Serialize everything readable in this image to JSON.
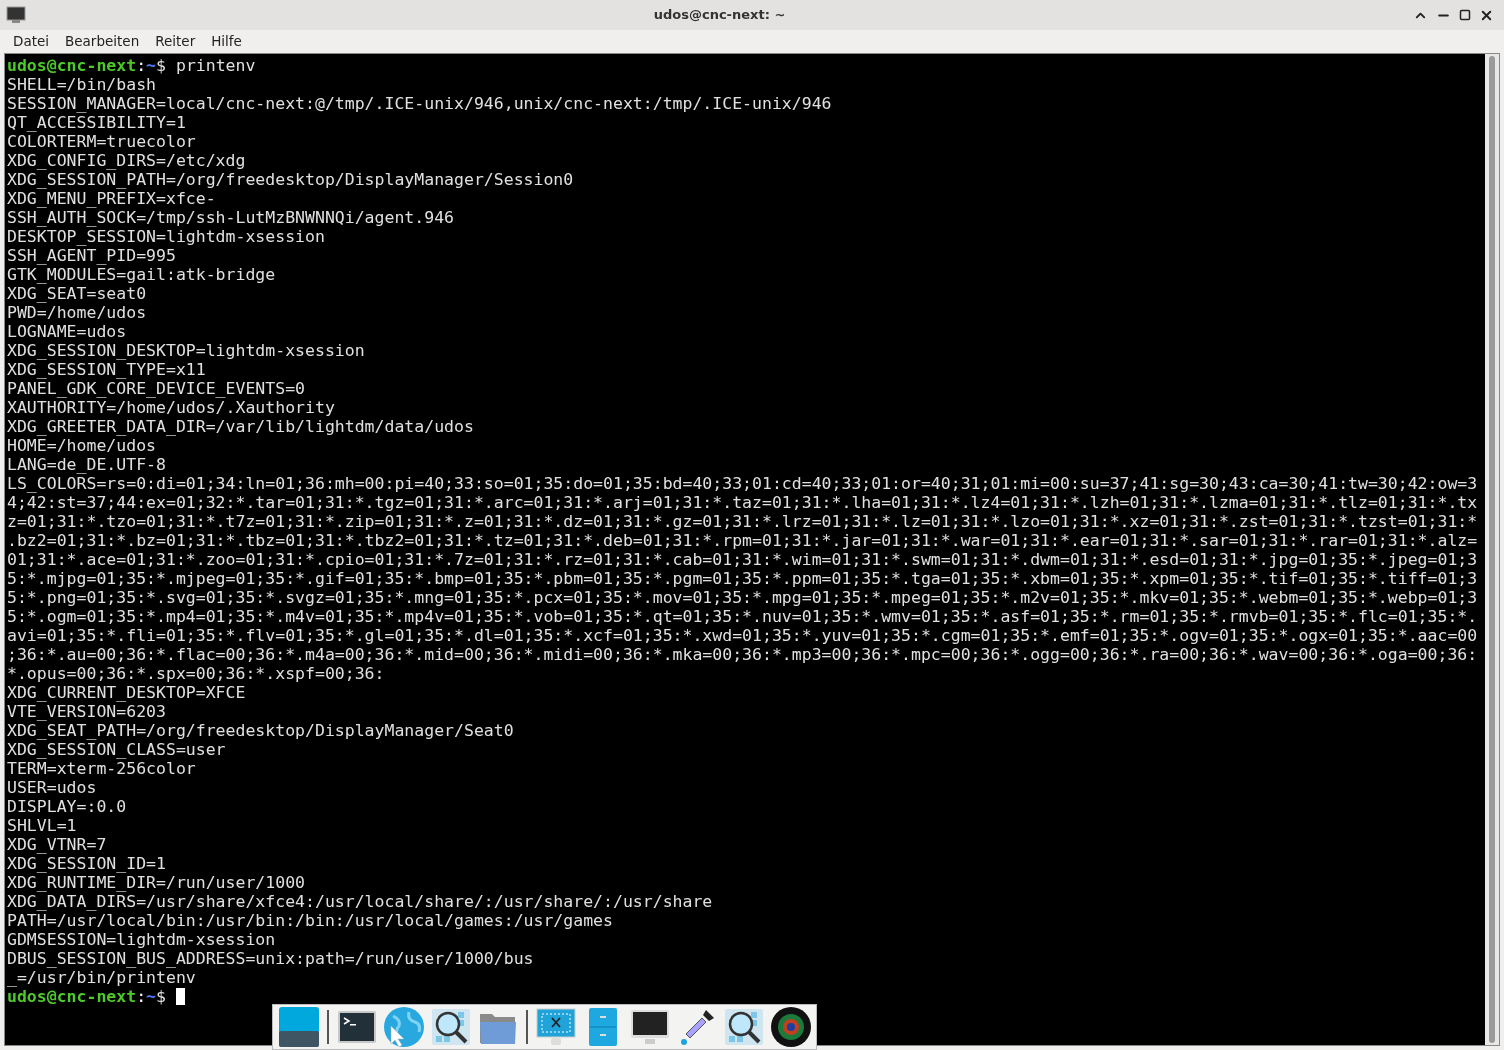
{
  "window": {
    "title": "udos@cnc-next: ~"
  },
  "menu": [
    "Datei",
    "Bearbeiten",
    "Reiter",
    "Hilfe"
  ],
  "terminal": {
    "lines": [
      {
        "kind": "prompt",
        "user": "udos@cnc-next",
        "separator": ":",
        "path": "~",
        "symbol": "$",
        "command": "printenv",
        "cursor": false
      },
      {
        "kind": "output",
        "text": "SHELL=/bin/bash"
      },
      {
        "kind": "output",
        "text": "SESSION_MANAGER=local/cnc-next:@/tmp/.ICE-unix/946,unix/cnc-next:/tmp/.ICE-unix/946"
      },
      {
        "kind": "output",
        "text": "QT_ACCESSIBILITY=1"
      },
      {
        "kind": "output",
        "text": "COLORTERM=truecolor"
      },
      {
        "kind": "output",
        "text": "XDG_CONFIG_DIRS=/etc/xdg"
      },
      {
        "kind": "output",
        "text": "XDG_SESSION_PATH=/org/freedesktop/DisplayManager/Session0"
      },
      {
        "kind": "output",
        "text": "XDG_MENU_PREFIX=xfce-"
      },
      {
        "kind": "output",
        "text": "SSH_AUTH_SOCK=/tmp/ssh-LutMzBNWNNQi/agent.946"
      },
      {
        "kind": "output",
        "text": "DESKTOP_SESSION=lightdm-xsession"
      },
      {
        "kind": "output",
        "text": "SSH_AGENT_PID=995"
      },
      {
        "kind": "output",
        "text": "GTK_MODULES=gail:atk-bridge"
      },
      {
        "kind": "output",
        "text": "XDG_SEAT=seat0"
      },
      {
        "kind": "output",
        "text": "PWD=/home/udos"
      },
      {
        "kind": "output",
        "text": "LOGNAME=udos"
      },
      {
        "kind": "output",
        "text": "XDG_SESSION_DESKTOP=lightdm-xsession"
      },
      {
        "kind": "output",
        "text": "XDG_SESSION_TYPE=x11"
      },
      {
        "kind": "output",
        "text": "PANEL_GDK_CORE_DEVICE_EVENTS=0"
      },
      {
        "kind": "output",
        "text": "XAUTHORITY=/home/udos/.Xauthority"
      },
      {
        "kind": "output",
        "text": "XDG_GREETER_DATA_DIR=/var/lib/lightdm/data/udos"
      },
      {
        "kind": "output",
        "text": "HOME=/home/udos"
      },
      {
        "kind": "output",
        "text": "LANG=de_DE.UTF-8"
      },
      {
        "kind": "output",
        "text": "LS_COLORS=rs=0:di=01;34:ln=01;36:mh=00:pi=40;33:so=01;35:do=01;35:bd=40;33;01:cd=40;33;01:or=40;31;01:mi=00:su=37;41:sg=30;43:ca=30;41:tw=30;42:ow=3"
      },
      {
        "kind": "output",
        "text": "4;42:st=37;44:ex=01;32:*.tar=01;31:*.tgz=01;31:*.arc=01;31:*.arj=01;31:*.taz=01;31:*.lha=01;31:*.lz4=01;31:*.lzh=01;31:*.lzma=01;31:*.tlz=01;31:*.tx"
      },
      {
        "kind": "output",
        "text": "z=01;31:*.tzo=01;31:*.t7z=01;31:*.zip=01;31:*.z=01;31:*.dz=01;31:*.gz=01;31:*.lrz=01;31:*.lz=01;31:*.lzo=01;31:*.xz=01;31:*.zst=01;31:*.tzst=01;31:*"
      },
      {
        "kind": "output",
        "text": ".bz2=01;31:*.bz=01;31:*.tbz=01;31:*.tbz2=01;31:*.tz=01;31:*.deb=01;31:*.rpm=01;31:*.jar=01;31:*.war=01;31:*.ear=01;31:*.sar=01;31:*.rar=01;31:*.alz="
      },
      {
        "kind": "output",
        "text": "01;31:*.ace=01;31:*.zoo=01;31:*.cpio=01;31:*.7z=01;31:*.rz=01;31:*.cab=01;31:*.wim=01;31:*.swm=01;31:*.dwm=01;31:*.esd=01;31:*.jpg=01;35:*.jpeg=01;3"
      },
      {
        "kind": "output",
        "text": "5:*.mjpg=01;35:*.mjpeg=01;35:*.gif=01;35:*.bmp=01;35:*.pbm=01;35:*.pgm=01;35:*.ppm=01;35:*.tga=01;35:*.xbm=01;35:*.xpm=01;35:*.tif=01;35:*.tiff=01;3"
      },
      {
        "kind": "output",
        "text": "5:*.png=01;35:*.svg=01;35:*.svgz=01;35:*.mng=01;35:*.pcx=01;35:*.mov=01;35:*.mpg=01;35:*.mpeg=01;35:*.m2v=01;35:*.mkv=01;35:*.webm=01;35:*.webp=01;3"
      },
      {
        "kind": "output",
        "text": "5:*.ogm=01;35:*.mp4=01;35:*.m4v=01;35:*.mp4v=01;35:*.vob=01;35:*.qt=01;35:*.nuv=01;35:*.wmv=01;35:*.asf=01;35:*.rm=01;35:*.rmvb=01;35:*.flc=01;35:*."
      },
      {
        "kind": "output",
        "text": "avi=01;35:*.fli=01;35:*.flv=01;35:*.gl=01;35:*.dl=01;35:*.xcf=01;35:*.xwd=01;35:*.yuv=01;35:*.cgm=01;35:*.emf=01;35:*.ogv=01;35:*.ogx=01;35:*.aac=00"
      },
      {
        "kind": "output",
        "text": ";36:*.au=00;36:*.flac=00;36:*.m4a=00;36:*.mid=00;36:*.midi=00;36:*.mka=00;36:*.mp3=00;36:*.mpc=00;36:*.ogg=00;36:*.ra=00;36:*.wav=00;36:*.oga=00;36:"
      },
      {
        "kind": "output",
        "text": "*.opus=00;36:*.spx=00;36:*.xspf=00;36:"
      },
      {
        "kind": "output",
        "text": "XDG_CURRENT_DESKTOP=XFCE"
      },
      {
        "kind": "output",
        "text": "VTE_VERSION=6203"
      },
      {
        "kind": "output",
        "text": "XDG_SEAT_PATH=/org/freedesktop/DisplayManager/Seat0"
      },
      {
        "kind": "output",
        "text": "XDG_SESSION_CLASS=user"
      },
      {
        "kind": "output",
        "text": "TERM=xterm-256color"
      },
      {
        "kind": "output",
        "text": "USER=udos"
      },
      {
        "kind": "output",
        "text": "DISPLAY=:0.0"
      },
      {
        "kind": "output",
        "text": "SHLVL=1"
      },
      {
        "kind": "output",
        "text": "XDG_VTNR=7"
      },
      {
        "kind": "output",
        "text": "XDG_SESSION_ID=1"
      },
      {
        "kind": "output",
        "text": "XDG_RUNTIME_DIR=/run/user/1000"
      },
      {
        "kind": "output",
        "text": "XDG_DATA_DIRS=/usr/share/xfce4:/usr/local/share/:/usr/share/:/usr/share"
      },
      {
        "kind": "output",
        "text": "PATH=/usr/local/bin:/usr/bin:/bin:/usr/local/games:/usr/games"
      },
      {
        "kind": "output",
        "text": "GDMSESSION=lightdm-xsession"
      },
      {
        "kind": "output",
        "text": "DBUS_SESSION_BUS_ADDRESS=unix:path=/run/user/1000/bus"
      },
      {
        "kind": "output",
        "text": "_=/usr/bin/printenv"
      },
      {
        "kind": "prompt",
        "user": "udos@cnc-next",
        "separator": ":",
        "path": "~",
        "symbol": "$",
        "cursor": true
      }
    ]
  },
  "dock": {
    "items": [
      {
        "kind": "desktop"
      },
      {
        "kind": "separator"
      },
      {
        "kind": "terminal"
      },
      {
        "kind": "globe"
      },
      {
        "kind": "search"
      },
      {
        "kind": "folder"
      },
      {
        "kind": "separator"
      },
      {
        "kind": "screenshot"
      },
      {
        "kind": "cabinet"
      },
      {
        "kind": "monitor"
      },
      {
        "kind": "eyedropper"
      },
      {
        "kind": "search"
      },
      {
        "kind": "lens"
      }
    ]
  }
}
